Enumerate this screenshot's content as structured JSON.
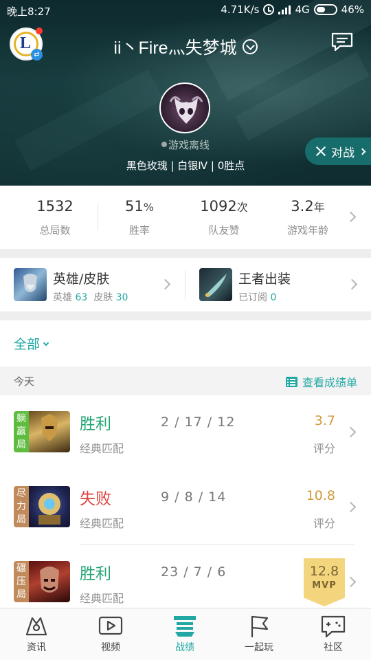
{
  "status_bar": {
    "time": "晚上8:27",
    "speed": "4.71K/s",
    "network": "4G",
    "battery": "46%",
    "battery_level": 0.46,
    "icons": [
      "alarm-icon",
      "signal-icon",
      "battery-icon"
    ]
  },
  "header": {
    "title": "ii丶Fire灬失梦城",
    "online_status": "游戏离线",
    "rank_line": "黑色玫瑰 | 白银Ⅳ | 0胜点",
    "battle_button": "对战",
    "icons": [
      "app-logo-icon",
      "dropdown-chevron-icon",
      "message-icon",
      "swords-icon"
    ]
  },
  "stats": [
    {
      "value": "1532",
      "unit": "",
      "label": "总局数"
    },
    {
      "value": "51",
      "unit": "%",
      "label": "胜率"
    },
    {
      "value": "1092",
      "unit": "次",
      "label": "队友赞"
    },
    {
      "value": "3.2",
      "unit": "年",
      "label": "游戏年龄"
    }
  ],
  "cards": {
    "heroes": {
      "title": "英雄/皮肤",
      "hero_label": "英雄",
      "hero_count": "63",
      "skin_label": "皮肤",
      "skin_count": "30"
    },
    "outfit": {
      "title": "王者出装",
      "sub_label": "已订阅",
      "sub_count": "0"
    }
  },
  "filter": {
    "label": "全部"
  },
  "section": {
    "today": "今天",
    "report_link": "查看成绩单"
  },
  "matches": [
    {
      "tag": "躺赢局",
      "tag_color": "#5ebd3e",
      "result": "胜利",
      "mode": "经典匹配",
      "kda": "2 / 17 / 12",
      "score": "3.7",
      "score_label": "评分"
    },
    {
      "tag": "尽力局",
      "tag_color": "#c08a5b",
      "result": "失败",
      "mode": "经典匹配",
      "kda": "9 / 8 / 14",
      "score": "10.8",
      "score_label": "评分"
    },
    {
      "tag": "碾压局",
      "tag_color": "#c08a5b",
      "result": "胜利",
      "mode": "经典匹配",
      "kda": "23 / 7 / 6",
      "score": "12.8",
      "score_label": "MVP"
    }
  ],
  "tabs": [
    {
      "label": "资讯",
      "icon": "news-icon"
    },
    {
      "label": "视频",
      "icon": "video-icon"
    },
    {
      "label": "战绩",
      "icon": "record-icon",
      "active": true
    },
    {
      "label": "一起玩",
      "icon": "flag-icon"
    },
    {
      "label": "社区",
      "icon": "community-icon"
    }
  ],
  "colors": {
    "accent": "#21a8a3",
    "win": "#21a470",
    "lose": "#e04040",
    "score": "#d09a3a",
    "mvp": "#f3d57e"
  }
}
